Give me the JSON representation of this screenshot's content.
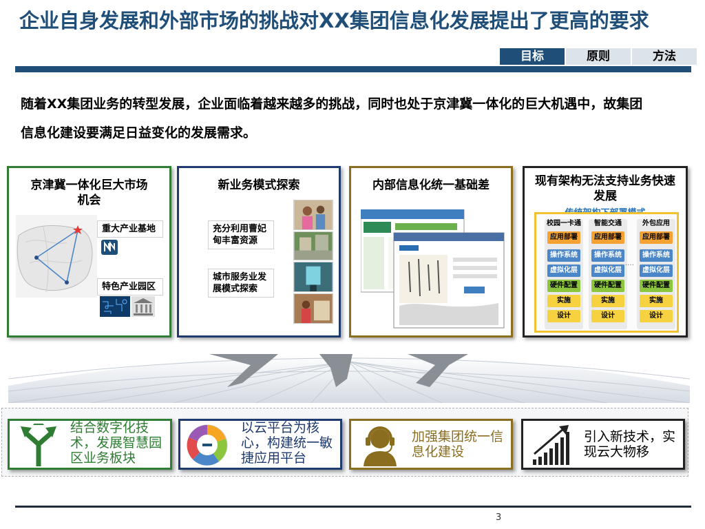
{
  "header": {
    "title": "企业自身发展和外部市场的挑战对XX集团信息化发展提出了更高的要求",
    "tabs": [
      {
        "label": "目标",
        "active": true
      },
      {
        "label": "原则",
        "active": false
      },
      {
        "label": "方法",
        "active": false
      }
    ]
  },
  "intro": "随着XX集团业务的转型发展，企业面临着越来越多的挑战，同时也处于京津冀一体化的巨大机遇中，故集团信息化建设要满足日益变化的发展需求。",
  "panels": [
    {
      "title": "京津冀一体化巨大市场机会",
      "items": [
        "重大产业基地",
        "特色产业园区"
      ]
    },
    {
      "title": "新业务模式探索",
      "items": [
        "充分利用曹妃甸丰富资源",
        "城市服务业发展模式探索"
      ]
    },
    {
      "title": "内部信息化统一基础差",
      "items": []
    },
    {
      "title": "现有架构无法支持业务快速发展",
      "subtitle": "传统架构下部署模式",
      "columns": [
        {
          "head": "校园一卡通",
          "cells": [
            "应用部署",
            "操作系统",
            "虚拟化层",
            "硬件配置",
            "实施",
            "设计"
          ]
        },
        {
          "head": "智能交通",
          "cells": [
            "应用部署",
            "操作系统",
            "虚拟化层",
            "硬件配置",
            "实施",
            "设计"
          ]
        },
        {
          "head": "外包应用",
          "cells": [
            "应用部署",
            "操作系统",
            "虚拟化层",
            "硬件配置",
            "实施",
            "设计"
          ]
        }
      ],
      "dots": "……"
    }
  ],
  "solutions": [
    {
      "text": "结合数字化技术，发展智慧园区业务板块",
      "icon": "split-arrows-icon"
    },
    {
      "text": "以云平台为核心，构建统一敏捷应用平台",
      "icon": "cloud-cycle-icon"
    },
    {
      "text": "加强集团统一信息化建设",
      "icon": "headset-person-icon"
    },
    {
      "text": "引入新技术，实现云大物移",
      "icon": "growth-bars-icon"
    }
  ],
  "footer": {
    "page": "3"
  },
  "colors": {
    "primary": "#1f4e79",
    "green": "#2e7d32",
    "navy": "#1f3a6e",
    "gold": "#8a6d1e",
    "archBorder": "#f2c230",
    "archSub": "#2e75b6"
  }
}
